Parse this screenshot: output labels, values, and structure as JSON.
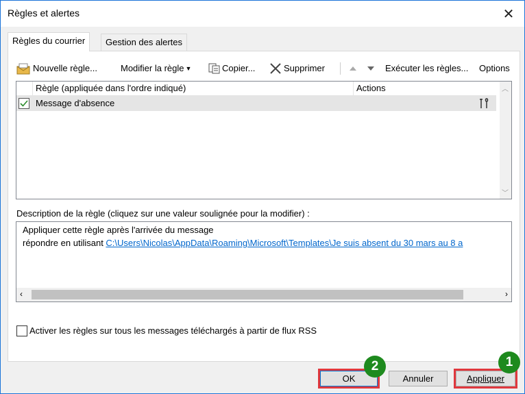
{
  "window": {
    "title": "Règles et alertes",
    "close_glyph": "✕"
  },
  "tabs": [
    {
      "label": "Règles du courrier",
      "active": true
    },
    {
      "label": "Gestion des alertes",
      "active": false
    }
  ],
  "toolbar": {
    "new_rule": "Nouvelle règle...",
    "modify_rule": "Modifier la règle",
    "copy": "Copier...",
    "delete": "Supprimer",
    "run_rules": "Exécuter les règles...",
    "options": "Options"
  },
  "rules_list": {
    "col_rule": "Règle (appliquée dans l'ordre indiqué)",
    "col_actions": "Actions",
    "rows": [
      {
        "name": "Message d'absence",
        "checked": true
      }
    ]
  },
  "description": {
    "label": "Description de la règle (cliquez sur une valeur soulignée pour la modifier) :",
    "line1": "Appliquer cette règle après l'arrivée du message",
    "line2_prefix": "répondre en utilisant ",
    "line2_link": "C:\\Users\\Nicolas\\AppData\\Roaming\\Microsoft\\Templates\\Je suis absent du 30 mars au 8 a"
  },
  "rss_checkbox": {
    "label": "Activer les règles sur tous les messages téléchargés à partir de flux RSS",
    "checked": false
  },
  "buttons": {
    "ok": "OK",
    "cancel": "Annuler",
    "apply": "Appliquer"
  },
  "badges": {
    "ok": "2",
    "apply": "1"
  },
  "colors": {
    "highlight": "#e0383e",
    "badge": "#1e8a1e",
    "link": "#0066cc",
    "selection": "#e5e5e5"
  }
}
